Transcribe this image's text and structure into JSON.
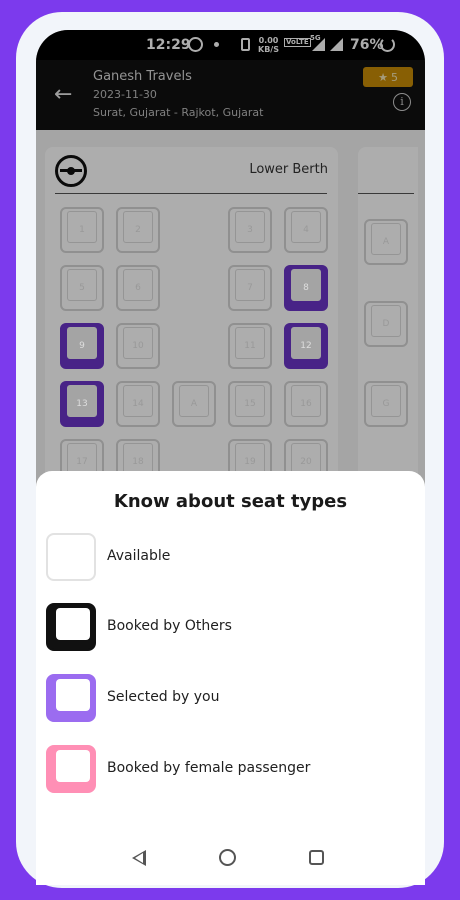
{
  "status_bar": {
    "time": "12:29",
    "speed_value": "0.00",
    "speed_unit": "KB/S",
    "volte": "VoLTE",
    "network": "5G",
    "battery": "76%"
  },
  "header": {
    "operator": "Ganesh Travels",
    "date": "2023-11-30",
    "route": "Surat, Gujarat - Rajkot, Gujarat",
    "rating": "5",
    "rating_icon": "star-icon",
    "info_icon": "info-icon"
  },
  "deck": {
    "title": "Lower Berth",
    "seats": [
      {
        "label": "1",
        "status": "available"
      },
      {
        "label": "2",
        "status": "available"
      },
      {
        "label": "3",
        "status": "available"
      },
      {
        "label": "4",
        "status": "available"
      },
      {
        "label": "5",
        "status": "available"
      },
      {
        "label": "6",
        "status": "available"
      },
      {
        "label": "7",
        "status": "available"
      },
      {
        "label": "8",
        "status": "selected"
      },
      {
        "label": "9",
        "status": "selected"
      },
      {
        "label": "10",
        "status": "available"
      },
      {
        "label": "11",
        "status": "available"
      },
      {
        "label": "12",
        "status": "selected"
      },
      {
        "label": "13",
        "status": "selected"
      },
      {
        "label": "14",
        "status": "available"
      },
      {
        "label": "A",
        "status": "available"
      },
      {
        "label": "15",
        "status": "available"
      },
      {
        "label": "16",
        "status": "available"
      },
      {
        "label": "17",
        "status": "available"
      },
      {
        "label": "18",
        "status": "available"
      },
      {
        "label": "19",
        "status": "available"
      },
      {
        "label": "20",
        "status": "available"
      }
    ],
    "side_seats": [
      {
        "label": "A",
        "status": "available"
      },
      {
        "label": "D",
        "status": "available"
      },
      {
        "label": "G",
        "status": "available"
      }
    ]
  },
  "sheet": {
    "title": "Know about seat types",
    "legend": [
      {
        "label": "Available",
        "color": "#ffffff",
        "border": "#e2e2e2"
      },
      {
        "label": "Booked by Others",
        "color": "#111111",
        "border": "#111111"
      },
      {
        "label": "Selected by you",
        "color": "#9b6cf0",
        "border": "#9b6cf0"
      },
      {
        "label": "Booked by female passenger",
        "color": "#ff8fb5",
        "border": "#ff8fb5"
      }
    ]
  }
}
